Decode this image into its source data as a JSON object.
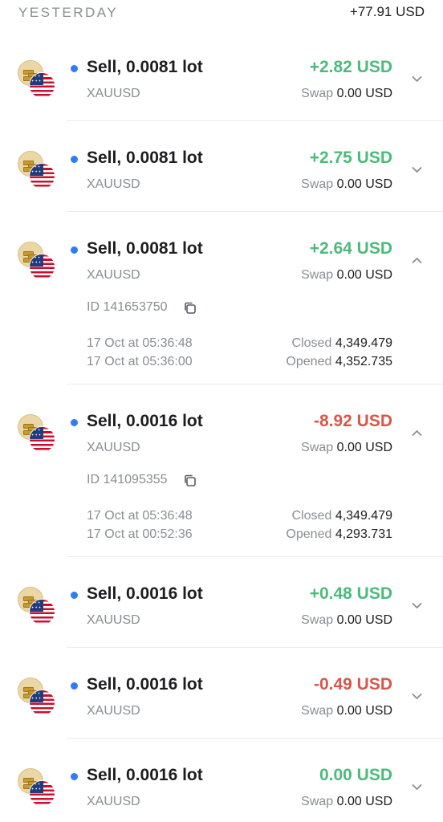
{
  "section": {
    "title": "YESTERDAY",
    "total": "+77.91 USD"
  },
  "colors": {
    "positive": "#4cbb7a",
    "negative": "#d8574a",
    "accent_dot": "#2f7cf6"
  },
  "icons": {
    "asset": "gold-usd-pair-icon",
    "collapse": "chevron-up-icon",
    "expand": "chevron-down-icon",
    "copy": "copy-icon"
  },
  "trades": [
    {
      "title": "Sell, 0.0081 lot",
      "symbol": "XAUUSD",
      "pnl": "+2.82 USD",
      "sign": "pos",
      "swap_label": "Swap",
      "swap_value": "0.00 USD",
      "expanded": false
    },
    {
      "title": "Sell, 0.0081 lot",
      "symbol": "XAUUSD",
      "pnl": "+2.75 USD",
      "sign": "pos",
      "swap_label": "Swap",
      "swap_value": "0.00 USD",
      "expanded": false
    },
    {
      "title": "Sell, 0.0081 lot",
      "symbol": "XAUUSD",
      "pnl": "+2.64 USD",
      "sign": "pos",
      "swap_label": "Swap",
      "swap_value": "0.00 USD",
      "expanded": true,
      "id": "ID 141653750",
      "close_time": "17 Oct at 05:36:48",
      "open_time": "17 Oct at 05:36:00",
      "closed_label": "Closed",
      "closed_price": "4,349.479",
      "opened_label": "Opened",
      "opened_price": "4,352.735"
    },
    {
      "title": "Sell, 0.0016 lot",
      "symbol": "XAUUSD",
      "pnl": "-8.92 USD",
      "sign": "neg",
      "swap_label": "Swap",
      "swap_value": "0.00 USD",
      "expanded": true,
      "id": "ID 141095355",
      "close_time": "17 Oct at 05:36:48",
      "open_time": "17 Oct at 00:52:36",
      "closed_label": "Closed",
      "closed_price": "4,349.479",
      "opened_label": "Opened",
      "opened_price": "4,293.731"
    },
    {
      "title": "Sell, 0.0016 lot",
      "symbol": "XAUUSD",
      "pnl": "+0.48 USD",
      "sign": "pos",
      "swap_label": "Swap",
      "swap_value": "0.00 USD",
      "expanded": false
    },
    {
      "title": "Sell, 0.0016 lot",
      "symbol": "XAUUSD",
      "pnl": "-0.49 USD",
      "sign": "neg",
      "swap_label": "Swap",
      "swap_value": "0.00 USD",
      "expanded": false
    },
    {
      "title": "Sell, 0.0016 lot",
      "symbol": "XAUUSD",
      "pnl": "0.00 USD",
      "sign": "pos",
      "swap_label": "Swap",
      "swap_value": "0.00 USD",
      "expanded": false
    }
  ]
}
